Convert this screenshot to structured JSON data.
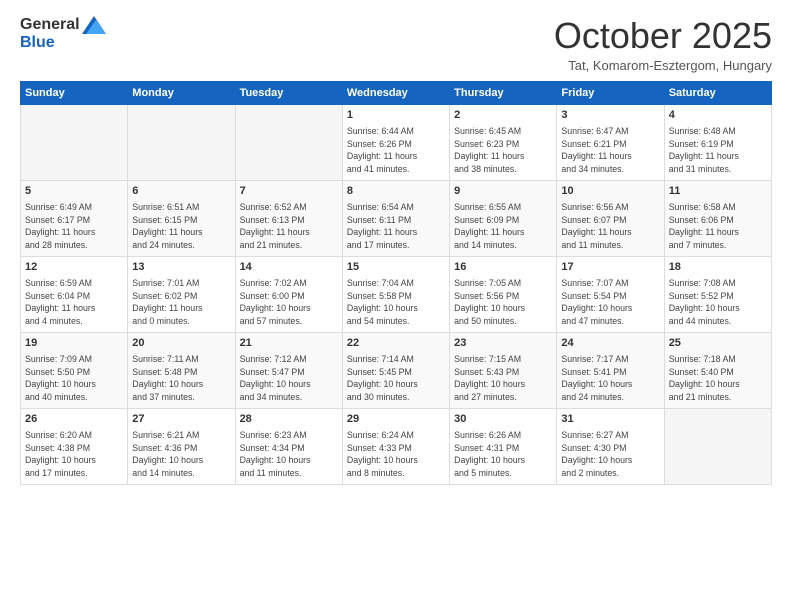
{
  "header": {
    "logo_general": "General",
    "logo_blue": "Blue",
    "month_title": "October 2025",
    "location": "Tat, Komarom-Esztergom, Hungary"
  },
  "weekdays": [
    "Sunday",
    "Monday",
    "Tuesday",
    "Wednesday",
    "Thursday",
    "Friday",
    "Saturday"
  ],
  "weeks": [
    [
      {
        "day": "",
        "info": ""
      },
      {
        "day": "",
        "info": ""
      },
      {
        "day": "",
        "info": ""
      },
      {
        "day": "1",
        "info": "Sunrise: 6:44 AM\nSunset: 6:26 PM\nDaylight: 11 hours\nand 41 minutes."
      },
      {
        "day": "2",
        "info": "Sunrise: 6:45 AM\nSunset: 6:23 PM\nDaylight: 11 hours\nand 38 minutes."
      },
      {
        "day": "3",
        "info": "Sunrise: 6:47 AM\nSunset: 6:21 PM\nDaylight: 11 hours\nand 34 minutes."
      },
      {
        "day": "4",
        "info": "Sunrise: 6:48 AM\nSunset: 6:19 PM\nDaylight: 11 hours\nand 31 minutes."
      }
    ],
    [
      {
        "day": "5",
        "info": "Sunrise: 6:49 AM\nSunset: 6:17 PM\nDaylight: 11 hours\nand 28 minutes."
      },
      {
        "day": "6",
        "info": "Sunrise: 6:51 AM\nSunset: 6:15 PM\nDaylight: 11 hours\nand 24 minutes."
      },
      {
        "day": "7",
        "info": "Sunrise: 6:52 AM\nSunset: 6:13 PM\nDaylight: 11 hours\nand 21 minutes."
      },
      {
        "day": "8",
        "info": "Sunrise: 6:54 AM\nSunset: 6:11 PM\nDaylight: 11 hours\nand 17 minutes."
      },
      {
        "day": "9",
        "info": "Sunrise: 6:55 AM\nSunset: 6:09 PM\nDaylight: 11 hours\nand 14 minutes."
      },
      {
        "day": "10",
        "info": "Sunrise: 6:56 AM\nSunset: 6:07 PM\nDaylight: 11 hours\nand 11 minutes."
      },
      {
        "day": "11",
        "info": "Sunrise: 6:58 AM\nSunset: 6:06 PM\nDaylight: 11 hours\nand 7 minutes."
      }
    ],
    [
      {
        "day": "12",
        "info": "Sunrise: 6:59 AM\nSunset: 6:04 PM\nDaylight: 11 hours\nand 4 minutes."
      },
      {
        "day": "13",
        "info": "Sunrise: 7:01 AM\nSunset: 6:02 PM\nDaylight: 11 hours\nand 0 minutes."
      },
      {
        "day": "14",
        "info": "Sunrise: 7:02 AM\nSunset: 6:00 PM\nDaylight: 10 hours\nand 57 minutes."
      },
      {
        "day": "15",
        "info": "Sunrise: 7:04 AM\nSunset: 5:58 PM\nDaylight: 10 hours\nand 54 minutes."
      },
      {
        "day": "16",
        "info": "Sunrise: 7:05 AM\nSunset: 5:56 PM\nDaylight: 10 hours\nand 50 minutes."
      },
      {
        "day": "17",
        "info": "Sunrise: 7:07 AM\nSunset: 5:54 PM\nDaylight: 10 hours\nand 47 minutes."
      },
      {
        "day": "18",
        "info": "Sunrise: 7:08 AM\nSunset: 5:52 PM\nDaylight: 10 hours\nand 44 minutes."
      }
    ],
    [
      {
        "day": "19",
        "info": "Sunrise: 7:09 AM\nSunset: 5:50 PM\nDaylight: 10 hours\nand 40 minutes."
      },
      {
        "day": "20",
        "info": "Sunrise: 7:11 AM\nSunset: 5:48 PM\nDaylight: 10 hours\nand 37 minutes."
      },
      {
        "day": "21",
        "info": "Sunrise: 7:12 AM\nSunset: 5:47 PM\nDaylight: 10 hours\nand 34 minutes."
      },
      {
        "day": "22",
        "info": "Sunrise: 7:14 AM\nSunset: 5:45 PM\nDaylight: 10 hours\nand 30 minutes."
      },
      {
        "day": "23",
        "info": "Sunrise: 7:15 AM\nSunset: 5:43 PM\nDaylight: 10 hours\nand 27 minutes."
      },
      {
        "day": "24",
        "info": "Sunrise: 7:17 AM\nSunset: 5:41 PM\nDaylight: 10 hours\nand 24 minutes."
      },
      {
        "day": "25",
        "info": "Sunrise: 7:18 AM\nSunset: 5:40 PM\nDaylight: 10 hours\nand 21 minutes."
      }
    ],
    [
      {
        "day": "26",
        "info": "Sunrise: 6:20 AM\nSunset: 4:38 PM\nDaylight: 10 hours\nand 17 minutes."
      },
      {
        "day": "27",
        "info": "Sunrise: 6:21 AM\nSunset: 4:36 PM\nDaylight: 10 hours\nand 14 minutes."
      },
      {
        "day": "28",
        "info": "Sunrise: 6:23 AM\nSunset: 4:34 PM\nDaylight: 10 hours\nand 11 minutes."
      },
      {
        "day": "29",
        "info": "Sunrise: 6:24 AM\nSunset: 4:33 PM\nDaylight: 10 hours\nand 8 minutes."
      },
      {
        "day": "30",
        "info": "Sunrise: 6:26 AM\nSunset: 4:31 PM\nDaylight: 10 hours\nand 5 minutes."
      },
      {
        "day": "31",
        "info": "Sunrise: 6:27 AM\nSunset: 4:30 PM\nDaylight: 10 hours\nand 2 minutes."
      },
      {
        "day": "",
        "info": ""
      }
    ]
  ]
}
